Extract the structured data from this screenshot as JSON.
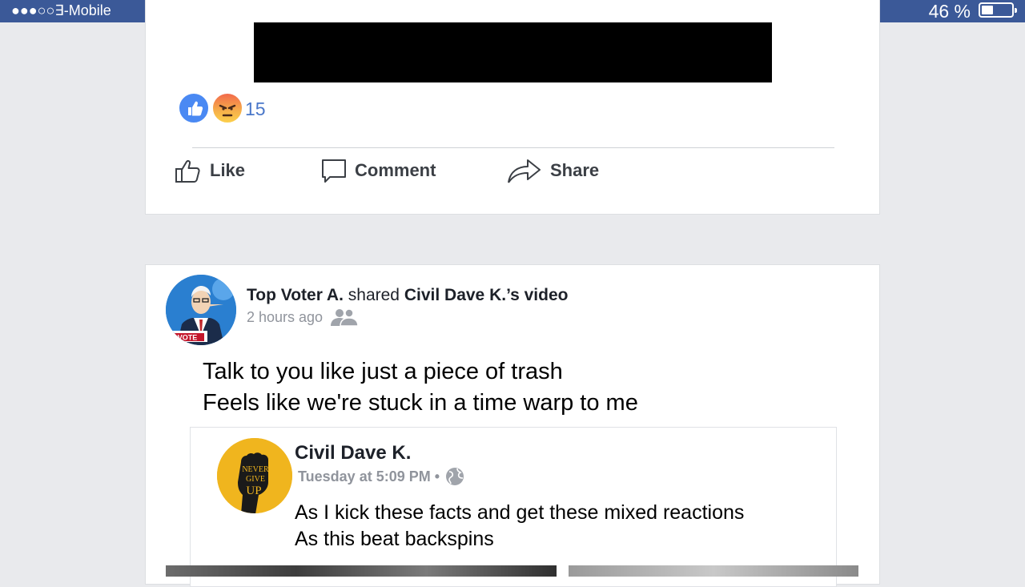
{
  "status_bar": {
    "carrier": "●●●○○∃-Mobile",
    "battery_percent": "46 %",
    "battery_level": 0.4
  },
  "post_top": {
    "reaction_icons": [
      "like-icon",
      "angry-icon"
    ],
    "reaction_count": "15",
    "actions": {
      "like": "Like",
      "comment": "Comment",
      "share": "Share"
    }
  },
  "post": {
    "author": "Top Voter A.",
    "verb": "shared",
    "shared_from": "Civil Dave K.’s video",
    "time": "2 hours ago",
    "privacy_icon": "friends-icon",
    "avatar_badge": "VOTE",
    "text_line1": "Talk to you like just a piece of trash",
    "text_line2": "Feels like we're stuck in a time warp to me",
    "shared_post": {
      "author": "Civil Dave K.",
      "time": "Tuesday at 5:09 PM •",
      "privacy_icon": "globe-icon",
      "avatar_text": [
        "NEVER",
        "GIVE",
        "UP"
      ],
      "text_line1": "As I kick these facts and get these mixed reactions",
      "text_line2": "As this beat backspins"
    }
  },
  "colors": {
    "status_bar": "#3b5998",
    "background": "#e9eaed",
    "reaction_count": "#4a77c9",
    "meta_gray": "#90949c"
  }
}
